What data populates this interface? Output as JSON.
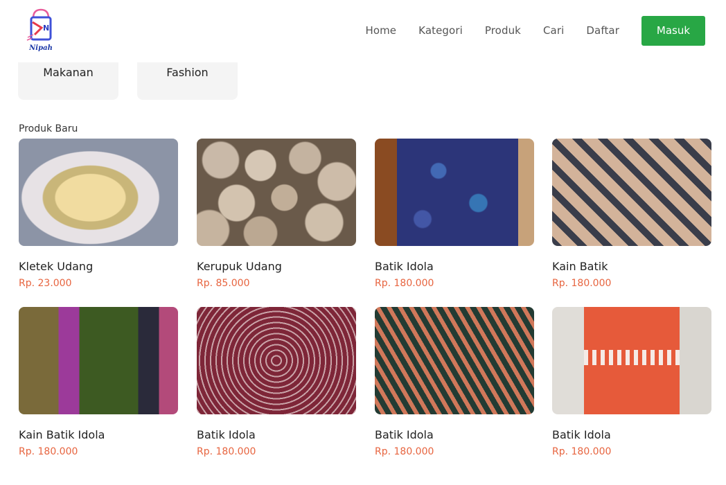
{
  "brand": {
    "logo_text": "Nipah",
    "accent": "#28a745",
    "price_color": "#e7643f"
  },
  "nav": {
    "items": [
      "Home",
      "Kategori",
      "Produk",
      "Cari",
      "Daftar"
    ],
    "login_label": "Masuk"
  },
  "categories": [
    "Makanan",
    "Fashion"
  ],
  "section": {
    "title": "Produk Baru"
  },
  "products": [
    {
      "name": "Kletek Udang",
      "price": "Rp. 23.000"
    },
    {
      "name": "Kerupuk Udang",
      "price": "Rp. 85.000"
    },
    {
      "name": "Batik Idola",
      "price": "Rp. 180.000"
    },
    {
      "name": "Kain Batik",
      "price": "Rp. 180.000"
    },
    {
      "name": "Kain Batik Idola",
      "price": "Rp. 180.000"
    },
    {
      "name": "Batik Idola",
      "price": "Rp. 180.000"
    },
    {
      "name": "Batik Idola",
      "price": "Rp. 180.000"
    },
    {
      "name": "Batik Idola",
      "price": "Rp. 180.000"
    }
  ]
}
